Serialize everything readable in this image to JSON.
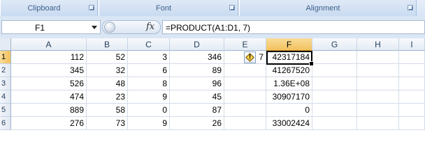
{
  "ribbon": {
    "groups": [
      {
        "label": "Clipboard"
      },
      {
        "label": "Font"
      },
      {
        "label": "Alignment"
      }
    ]
  },
  "formula_bar": {
    "name_box": "F1",
    "fx_label": "fx",
    "formula": "=PRODUCT(A1:D1, 7)"
  },
  "grid": {
    "columns": [
      "A",
      "B",
      "C",
      "D",
      "E",
      "F",
      "G",
      "H",
      "I"
    ],
    "rows": [
      "1",
      "2",
      "3",
      "4",
      "5",
      "6"
    ],
    "cells": [
      [
        "112",
        "52",
        "3",
        "346",
        "7",
        "42317184",
        "",
        "",
        ""
      ],
      [
        "345",
        "32",
        "6",
        "89",
        "",
        "41267520",
        "",
        "",
        ""
      ],
      [
        "526",
        "48",
        "8",
        "96",
        "",
        "1.36E+08",
        "",
        "",
        ""
      ],
      [
        "474",
        "23",
        "9",
        "45",
        "",
        "30907170",
        "",
        "",
        ""
      ],
      [
        "889",
        "58",
        "0",
        "87",
        "",
        "0",
        "",
        "",
        ""
      ],
      [
        "276",
        "73",
        "9",
        "26",
        "",
        "33002424",
        "",
        "",
        ""
      ]
    ],
    "active_cell": "F1"
  },
  "colors": {
    "ribbon_text": "#3e5f8a",
    "header_selected": "#f2c15d",
    "active_border": "#000000"
  }
}
